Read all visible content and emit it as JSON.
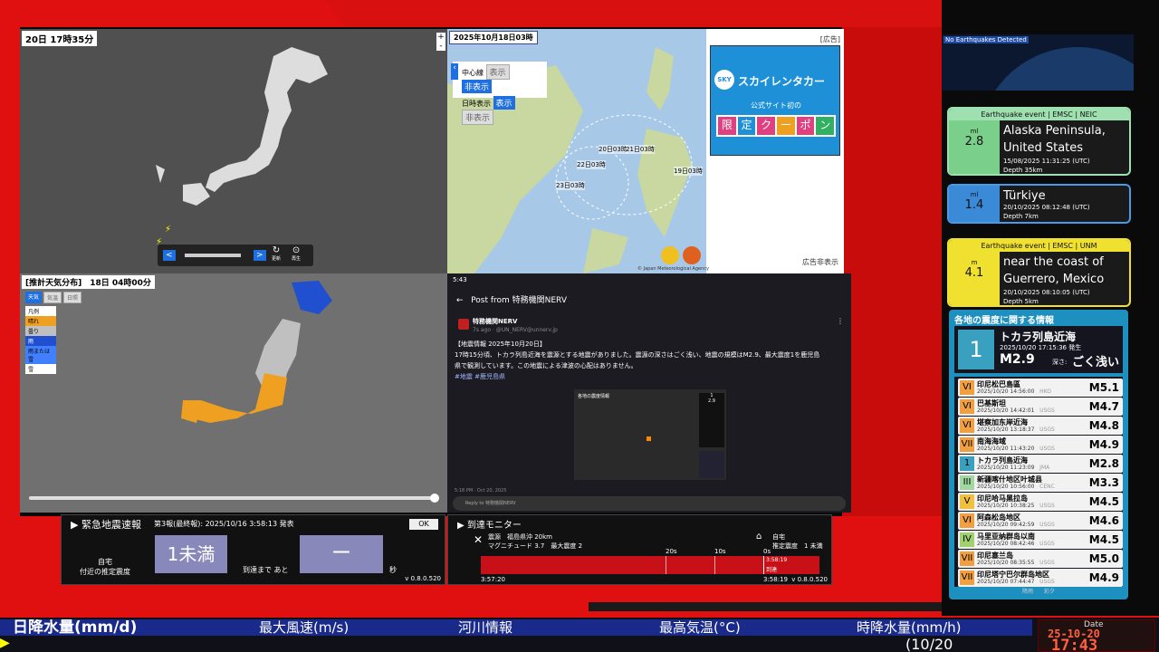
{
  "map_lightning": {
    "title": "20日 17時35分",
    "zoom_in": "+",
    "zoom_out": "-",
    "prev": "<",
    "next": ">",
    "update_label": "更新",
    "play_label": "再生"
  },
  "map_typhoon": {
    "title": "2025年10月18日03時",
    "center_line_label": "中心線",
    "show": "表示",
    "hide": "非表示",
    "time_label": "日時表示",
    "forecast_labels": [
      "20日03時",
      "21日03時",
      "22日03時",
      "23日03時",
      "19日03時"
    ],
    "ad_label": "[広告]",
    "ad_brand": "スカイレンタカー",
    "ad_sub": "公式サイト初の",
    "ad_coupon": [
      "限",
      "定",
      "ク",
      "ー",
      "ポ",
      "ン"
    ],
    "ad_hide": "広告非表示",
    "credit": "© Japan Meteorological Agency"
  },
  "map_weather": {
    "title": "[推計天気分布]　18日 04時00分",
    "tabs": [
      "天気",
      "気温",
      "日照"
    ],
    "legend_title": "凡例",
    "legend": [
      {
        "label": "晴れ",
        "color": "#f0a020"
      },
      {
        "label": "曇り",
        "color": "#c0c0c0"
      },
      {
        "label": "雨",
        "color": "#2050d0"
      },
      {
        "label": "雨または雪",
        "color": "#4080ff"
      },
      {
        "label": "雪",
        "color": "#ffffff"
      }
    ]
  },
  "social": {
    "status_time": "5:43",
    "header": "Post from 特務機関NERV",
    "account": "特務機関NERV",
    "meta": "7s ago · @UN_NERV@unnerv.jp",
    "body_lines": [
      "【地震情報 2025年10月20日】",
      "17時15分頃、トカラ列島近海を震源とする地震がありました。震源の深さはごく浅い、地震の規模はM2.9、最大震度1を鹿児島",
      "県で観測しています。この地震による津波の心配はありません。"
    ],
    "tags": "#地震 #鹿児島県",
    "post_time": "5:18 PM · Oct 20, 2025",
    "reply_placeholder": "Reply to 特務機関NERV",
    "image_title": "各地の震度情報",
    "image_values": [
      "1",
      "2.9"
    ]
  },
  "eew": {
    "title": "緊急地震速報",
    "report": "第3報(最終報): 2025/10/16 3:58:13 発表",
    "ok": "OK",
    "home_label_1": "自宅",
    "home_label_2": "付近の推定震度",
    "intensity": "1未満",
    "until_label": "到達まで あと",
    "countdown": "ー",
    "sec": "秒",
    "version": "v 0.8.0.520"
  },
  "arrival": {
    "title": "到達モニター",
    "epicenter": "震源　福島県沖 20km",
    "magnitude": "マグニチュード 3.7　最大震度 2",
    "home": "自宅",
    "home_intensity": "推定震度　1 未満",
    "ticks": [
      "20s",
      "10s",
      "0s"
    ],
    "now_time": "3:58:19",
    "arrived": "到達",
    "start_time": "3:57:20",
    "end_time": "3:58:19",
    "version": "v 0.8.0.520"
  },
  "globe": {
    "status": "No Earthquakes Detected"
  },
  "eq_cards": [
    {
      "header": "Earthquake event | EMSC | NEIC",
      "color": "#7ad08a",
      "border": "#9fe0b0",
      "mag_type": "ml",
      "mag": "2.8",
      "place1": "Alaska Peninsula,",
      "place2": "United States",
      "time": "15/08/2025 11:31:25 (UTC)",
      "depth": "Depth 35km"
    },
    {
      "header": "",
      "color": "#3a8ad8",
      "border": "#4a9ae8",
      "mag_type": "ml",
      "mag": "1.4",
      "place1": "Türkiye",
      "place2": "",
      "time": "20/10/2025 08:12:48 (UTC)",
      "depth": "Depth 7km"
    },
    {
      "header": "Earthquake event | EMSC | UNM",
      "color": "#f0e030",
      "border": "#f0e030",
      "mag_type": "m",
      "mag": "4.1",
      "place1": "near the coast of",
      "place2": "Guerrero, Mexico",
      "time": "20/10/2025 08:10:05 (UTC)",
      "depth": "Depth 5km"
    }
  ],
  "intensity_info": {
    "title": "各地の震度に関する情報",
    "main_intensity": "1",
    "main_place": "トカラ列島近海",
    "main_time": "2025/10/20 17:15:36 発生",
    "main_mag": "M2.9",
    "depth_label": "深さ:",
    "depth": "ごく浅い",
    "footer": "降雨　　彩夕",
    "rows": [
      {
        "int": "VI",
        "name": "印尼松巴島區",
        "time": "2025/10/20 14:56:00",
        "src": "HKO",
        "mag": "M5.1",
        "color": "#f0a040"
      },
      {
        "int": "VI",
        "name": "巴基斯坦",
        "time": "2025/10/20 14:42:01",
        "src": "USGS",
        "mag": "M4.7",
        "color": "#f0a040"
      },
      {
        "int": "VI",
        "name": "堪察加东岸近海",
        "time": "2025/10/20 13:18:37",
        "src": "USGS",
        "mag": "M4.8",
        "color": "#f0a040"
      },
      {
        "int": "VII",
        "name": "南海海域",
        "time": "2025/10/20 11:43:20",
        "src": "USGS",
        "mag": "M4.9",
        "color": "#f0a040"
      },
      {
        "int": "1",
        "name": "トカラ列島近海",
        "time": "2025/10/20 11:23:09",
        "src": "JMA",
        "mag": "M2.8",
        "color": "#3aa0c0"
      },
      {
        "int": "III",
        "name": "新疆喀什地区叶城县",
        "time": "2025/10/20 10:56:00",
        "src": "CENC",
        "mag": "M3.3",
        "color": "#a0d8a0"
      },
      {
        "int": "V",
        "name": "印尼哈马黑拉岛",
        "time": "2025/10/20 10:38:25",
        "src": "USGS",
        "mag": "M4.5",
        "color": "#f0c040"
      },
      {
        "int": "VI",
        "name": "阿森松岛地区",
        "time": "2025/10/20 09:42:59",
        "src": "USGS",
        "mag": "M4.6",
        "color": "#f0a040"
      },
      {
        "int": "IV",
        "name": "马里亚纳群岛以南",
        "time": "2025/10/20 08:42:46",
        "src": "USGS",
        "mag": "M4.5",
        "color": "#a0d070"
      },
      {
        "int": "VII",
        "name": "印尼塞兰岛",
        "time": "2025/10/20 08:35:55",
        "src": "USGS",
        "mag": "M5.0",
        "color": "#f0a040"
      },
      {
        "int": "VII",
        "name": "印尼塔宁巴尔群岛地区",
        "time": "2025/10/20 07:44:47",
        "src": "USGS",
        "mag": "M4.9",
        "color": "#f0a040"
      }
    ]
  },
  "ticker": {
    "items": [
      "日降水量(mm/d)",
      "最大風速(m/s)",
      "河川情報",
      "最高気温(°C)",
      "時降水量(mm/h)"
    ],
    "sub": "(10/20",
    "date_label": "Date",
    "date": "25-10-20",
    "clock": "17:43"
  }
}
